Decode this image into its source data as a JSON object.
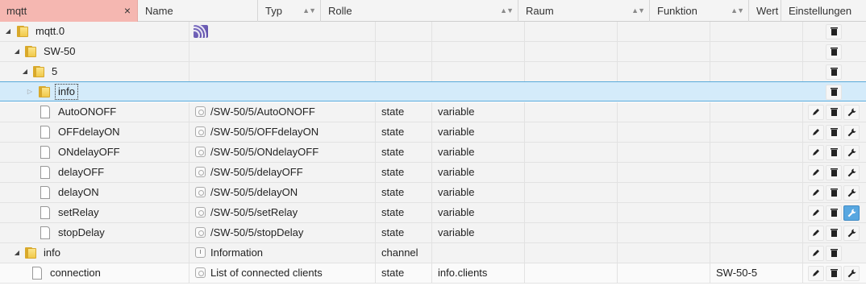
{
  "header": {
    "filter_value": "mqtt",
    "clear_label": "×",
    "name_label": "Name",
    "typ_label": "Typ",
    "rolle_label": "Rolle",
    "raum_label": "Raum",
    "funktion_label": "Funktion",
    "wert_label": "Wert",
    "einstellungen_label": "Einstellungen"
  },
  "tree": {
    "mqtt0": "mqtt.0",
    "sw50": "SW-50",
    "n5": "5",
    "info_folder": "info",
    "info_channel": "info"
  },
  "states": [
    {
      "id": "AutoONOFF",
      "name": "/SW-50/5/AutoONOFF",
      "type": "state",
      "role": "variable",
      "value": ""
    },
    {
      "id": "OFFdelayON",
      "name": "/SW-50/5/OFFdelayON",
      "type": "state",
      "role": "variable",
      "value": ""
    },
    {
      "id": "ONdelayOFF",
      "name": "/SW-50/5/ONdelayOFF",
      "type": "state",
      "role": "variable",
      "value": ""
    },
    {
      "id": "delayOFF",
      "name": "/SW-50/5/delayOFF",
      "type": "state",
      "role": "variable",
      "value": ""
    },
    {
      "id": "delayON",
      "name": "/SW-50/5/delayON",
      "type": "state",
      "role": "variable",
      "value": ""
    },
    {
      "id": "setRelay",
      "name": "/SW-50/5/setRelay",
      "type": "state",
      "role": "variable",
      "value": ""
    },
    {
      "id": "stopDelay",
      "name": "/SW-50/5/stopDelay",
      "type": "state",
      "role": "variable",
      "value": ""
    }
  ],
  "info_channel_row": {
    "name": "Information",
    "type": "channel"
  },
  "connection_row": {
    "id": "connection",
    "name": "List of connected clients",
    "type": "state",
    "role": "info.clients",
    "value": "SW-50-5"
  },
  "icons": {
    "expand": "expanded-triangle-icon",
    "collapse": "collapsed-triangle-icon",
    "edit": "pencil-icon",
    "delete": "trash-icon",
    "settings": "wrench-icon"
  },
  "colors": {
    "filter_bg": "#f5b7b1",
    "selected_bg": "#d4ebfa",
    "selected_border": "#5aa9d9",
    "active_button": "#58a7e0"
  }
}
